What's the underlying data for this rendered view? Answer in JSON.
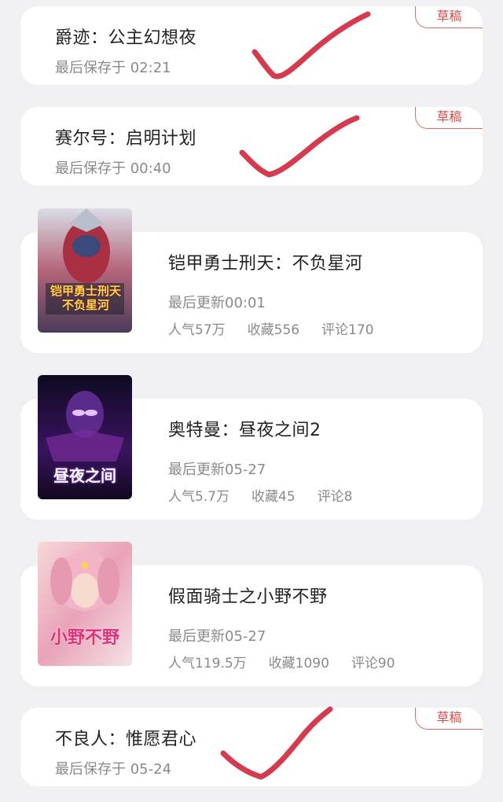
{
  "drafts": [
    {
      "title": "爵迹：公主幻想夜",
      "saved": "最后保存于 02:21",
      "badge": "草稿"
    },
    {
      "title": "赛尔号：启明计划",
      "saved": "最后保存于 00:40",
      "badge": "草稿"
    },
    {
      "title": "不良人：惟愿君心",
      "saved": "最后保存于 05-24",
      "badge": "草稿"
    }
  ],
  "books": [
    {
      "title": "铠甲勇士刑天：不负星河",
      "updated": "最后更新00:01",
      "popularity": "人气57万",
      "favorites": "收藏556",
      "comments": "评论170",
      "cover_text": "铠甲勇士刑天 不负星河"
    },
    {
      "title": "奥特曼：昼夜之间2",
      "updated": "最后更新05-27",
      "popularity": "人气5.7万",
      "favorites": "收藏45",
      "comments": "评论8",
      "cover_text": "昼夜之间"
    },
    {
      "title": "假面骑士之小野不野",
      "updated": "最后更新05-27",
      "popularity": "人气119.5万",
      "favorites": "收藏1090",
      "comments": "评论90",
      "cover_text": "小野不野"
    }
  ],
  "colors": {
    "badge": "#d84d4d",
    "checkmark": "#d63a4e",
    "page_bg": "#f0f0f2"
  }
}
